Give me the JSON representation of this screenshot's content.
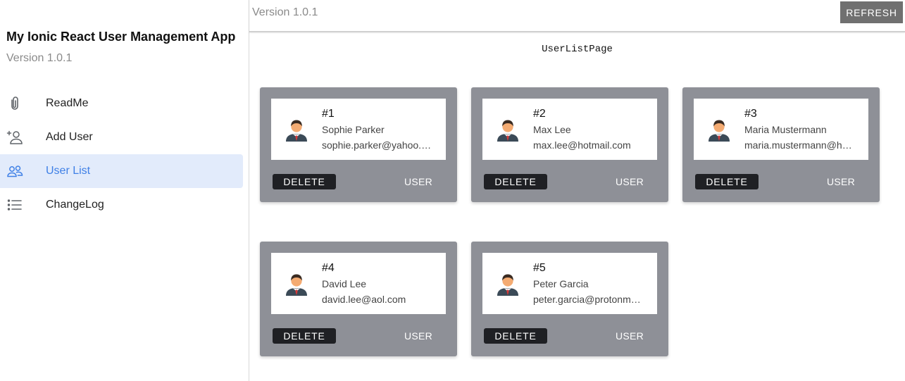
{
  "sidebar": {
    "title": "My Ionic React User Management App",
    "version": "Version 1.0.1",
    "items": [
      {
        "label": "ReadMe",
        "icon": "paperclip-icon"
      },
      {
        "label": "Add User",
        "icon": "person-add-icon"
      },
      {
        "label": "User List",
        "icon": "people-icon",
        "active": true
      },
      {
        "label": "ChangeLog",
        "icon": "list-icon"
      }
    ]
  },
  "header": {
    "version": "Version 1.0.1",
    "refresh_label": "REFRESH"
  },
  "page": {
    "title": "UserListPage"
  },
  "users": [
    {
      "num": "#1",
      "name": "Sophie Parker",
      "email": "sophie.parker@yahoo.com",
      "delete_label": "DELETE",
      "user_label": "USER"
    },
    {
      "num": "#2",
      "name": "Max Lee",
      "email": "max.lee@hotmail.com",
      "delete_label": "DELETE",
      "user_label": "USER"
    },
    {
      "num": "#3",
      "name": "Maria Mustermann",
      "email": "maria.mustermann@hotmail.com",
      "delete_label": "DELETE",
      "user_label": "USER"
    },
    {
      "num": "#4",
      "name": "David Lee",
      "email": "david.lee@aol.com",
      "delete_label": "DELETE",
      "user_label": "USER"
    },
    {
      "num": "#5",
      "name": "Peter Garcia",
      "email": "peter.garcia@protonmail.com",
      "delete_label": "DELETE",
      "user_label": "USER"
    }
  ],
  "colors": {
    "accent": "#3f80e6",
    "active_bg": "#e2ebfb",
    "card_bg": "#8e9097",
    "delete_bg": "#1f2024",
    "refresh_bg": "#707070"
  }
}
